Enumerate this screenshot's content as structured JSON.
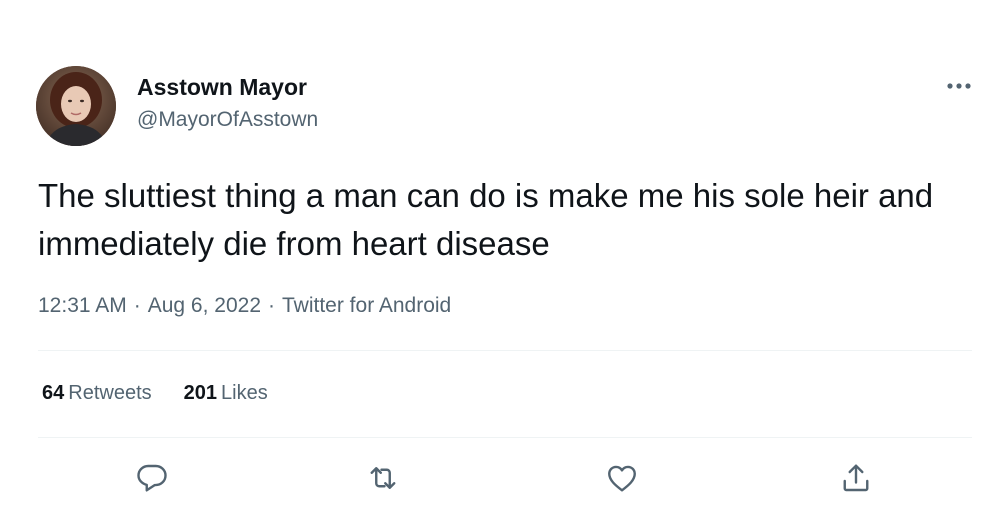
{
  "tweet": {
    "author": {
      "display_name": "Asstown Mayor",
      "handle": "@MayorOfAsstown"
    },
    "text": "The sluttiest thing a man can do is make me his sole heir and immediately die from heart disease",
    "meta": {
      "time": "12:31 AM",
      "separator": "·",
      "date": "Aug 6, 2022",
      "source": "Twitter for Android"
    },
    "stats": {
      "retweets_count": "64",
      "retweets_label": "Retweets",
      "likes_count": "201",
      "likes_label": "Likes"
    },
    "actions": [
      {
        "icon": "reply-icon"
      },
      {
        "icon": "retweet-icon"
      },
      {
        "icon": "like-icon"
      },
      {
        "icon": "share-icon"
      }
    ],
    "more_icon": "more-options-icon"
  },
  "colors": {
    "text_primary": "#0f1419",
    "text_secondary": "#536471",
    "divider": "#eff3f4",
    "icon": "#536471"
  }
}
